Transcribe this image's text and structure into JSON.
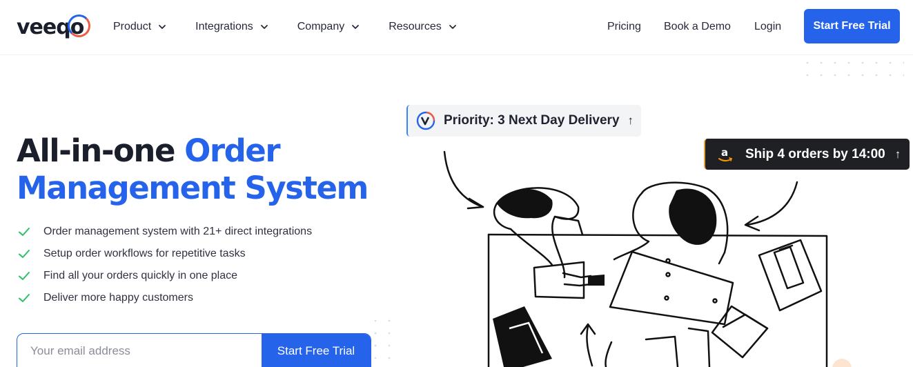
{
  "brand": {
    "logo_text": "veeqo"
  },
  "nav": {
    "items": [
      {
        "label": "Product"
      },
      {
        "label": "Integrations"
      },
      {
        "label": "Company"
      },
      {
        "label": "Resources"
      }
    ],
    "pricing": "Pricing",
    "book_demo": "Book a Demo",
    "login": "Login",
    "cta": "Start Free Trial"
  },
  "hero": {
    "title_part1": "All-in-one ",
    "title_highlight_1": "Order",
    "title_highlight_2": "Management System",
    "features": [
      "Order management system with 21+ direct integrations",
      "Setup order workflows for repetitive tasks",
      "Find all your orders quickly in one place",
      "Deliver more happy customers"
    ],
    "email_placeholder": "Your email address",
    "email_cta": "Start Free Trial"
  },
  "badges": {
    "priority": "Priority: 3 Next Day Delivery",
    "ship": "Ship 4 orders by 14:00",
    "arrow": "↑"
  },
  "colors": {
    "accent": "#2563eb",
    "check": "#22c55e",
    "dark_chip": "#1f2023",
    "amazon_orange": "#ff9900"
  },
  "icons": [
    "chevron-down-icon",
    "check-icon",
    "veeqo-v-icon",
    "amazon-icon",
    "arrow-up-icon"
  ]
}
